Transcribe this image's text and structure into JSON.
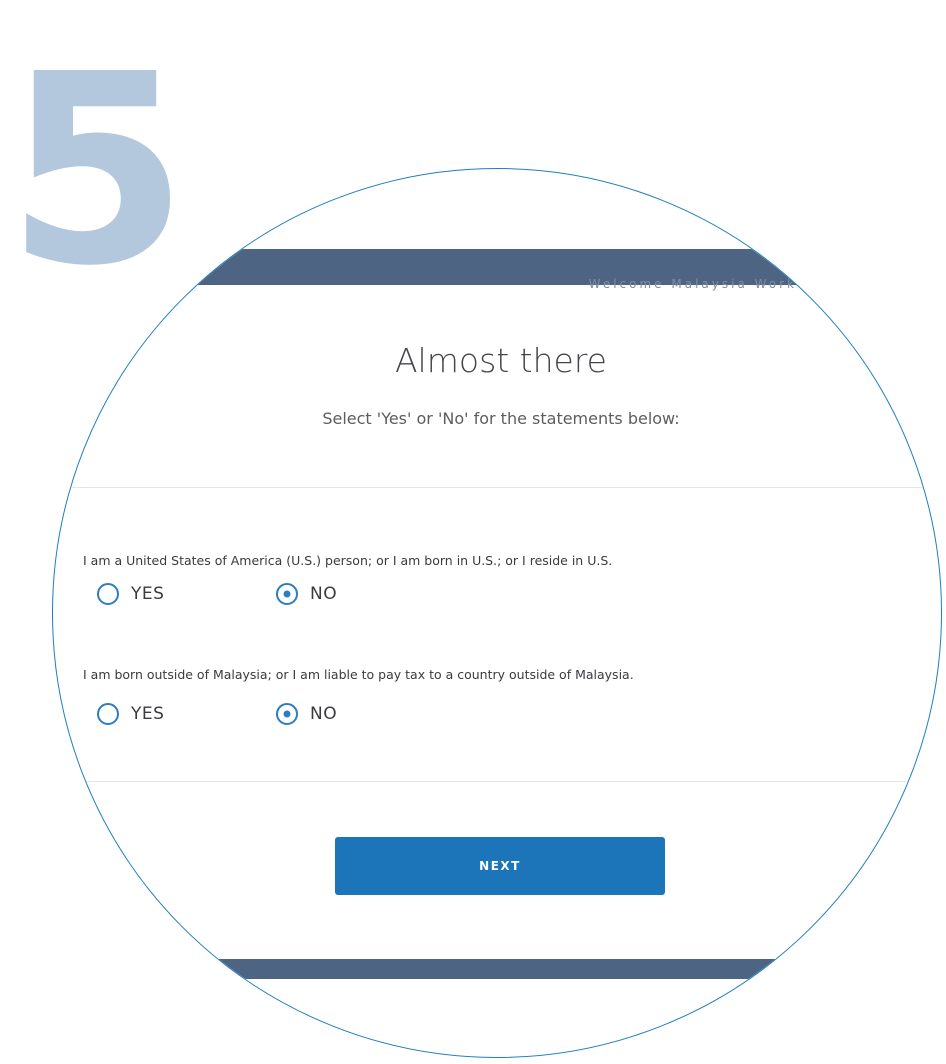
{
  "step_number": "5",
  "header": {
    "nav_text": "Welcome  Malaysia  Work"
  },
  "main": {
    "title": "Almost there",
    "subtitle": "Select 'Yes' or 'No' for the statements below:"
  },
  "questions": [
    {
      "text": "I am a United States of America (U.S.) person; or I am born in U.S.; or I reside in U.S.",
      "yes_label": "YES",
      "no_label": "NO",
      "selected": "NO"
    },
    {
      "text": "I am born outside of Malaysia; or I am liable to pay tax to a country outside of Malaysia.",
      "yes_label": "YES",
      "no_label": "NO",
      "selected": "NO"
    }
  ],
  "actions": {
    "next_label": "NEXT"
  },
  "colors": {
    "accent": "#1b75b8",
    "bar": "#4d6482",
    "step_number": "#b3c8dc",
    "lens_border": "#1f7fbf"
  }
}
